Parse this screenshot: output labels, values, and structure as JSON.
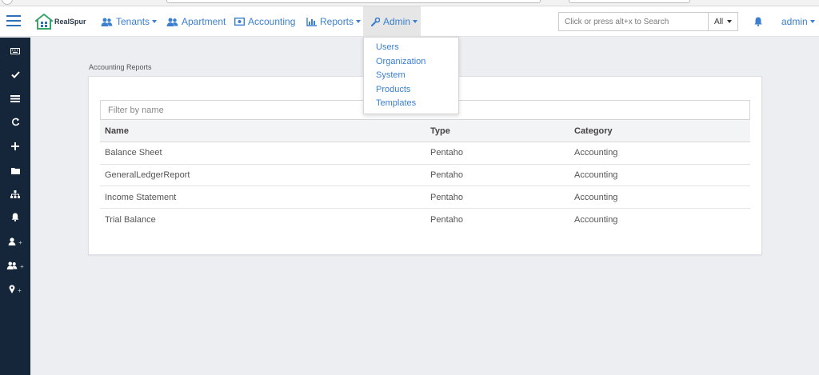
{
  "navbar": {
    "logo_text": "RealSpur",
    "items": [
      {
        "label": "Tenants",
        "icon": "users-icon",
        "has_caret": true
      },
      {
        "label": "Apartment",
        "icon": "users-icon",
        "has_caret": false
      },
      {
        "label": "Accounting",
        "icon": "money-icon",
        "has_caret": false
      },
      {
        "label": "Reports",
        "icon": "bar-chart-icon",
        "has_caret": true
      },
      {
        "label": "Admin",
        "icon": "wrench-icon",
        "has_caret": true
      }
    ],
    "search_placeholder": "Click or press alt+x to Search",
    "search_scope": "All",
    "user": "admin"
  },
  "admin_menu": {
    "items": [
      "Users",
      "Organization",
      "System",
      "Products",
      "Templates"
    ]
  },
  "sidebar": {
    "items": [
      {
        "icon": "keyboard-icon",
        "plus": ""
      },
      {
        "icon": "check-icon",
        "plus": ""
      },
      {
        "icon": "list-icon",
        "plus": ""
      },
      {
        "icon": "refresh-icon",
        "plus": ""
      },
      {
        "icon": "plus-icon",
        "plus": ""
      },
      {
        "icon": "folder-icon",
        "plus": ""
      },
      {
        "icon": "sitemap-icon",
        "plus": ""
      },
      {
        "icon": "bell-icon",
        "plus": ""
      },
      {
        "icon": "user-icon",
        "plus": "+"
      },
      {
        "icon": "users-icon",
        "plus": "+"
      },
      {
        "icon": "map-marker-icon",
        "plus": "+"
      }
    ]
  },
  "main": {
    "section_title": "Accounting Reports",
    "filter_placeholder": "Filter by name",
    "columns": [
      "Name",
      "Type",
      "Category"
    ],
    "rows": [
      [
        "Balance Sheet",
        "Pentaho",
        "Accounting"
      ],
      [
        "GeneralLedgerReport",
        "Pentaho",
        "Accounting"
      ],
      [
        "Income Statement",
        "Pentaho",
        "Accounting"
      ],
      [
        "Trial Balance",
        "Pentaho",
        "Accounting"
      ]
    ]
  },
  "colors": {
    "accent": "#3b7fd0",
    "sidebar_bg": "#15253a",
    "page_bg": "#eceef1"
  }
}
